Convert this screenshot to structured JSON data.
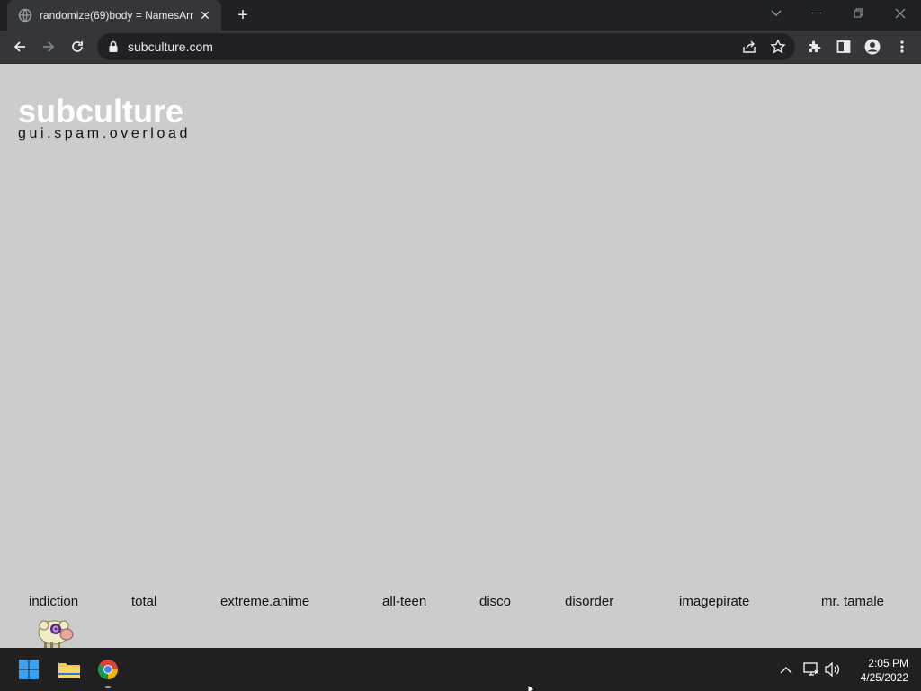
{
  "browser": {
    "tab_title": "randomize(69)body = NamesArr",
    "url": "subculture.com"
  },
  "page": {
    "logo": "subculture",
    "tagline": "gui.spam.overload",
    "nav": [
      "indiction",
      "total",
      "extreme.anime",
      "all-teen",
      "disco",
      "disorder",
      "imagepirate",
      "mr. tamale"
    ]
  },
  "taskbar": {
    "time": "2:05 PM",
    "date": "4/25/2022"
  },
  "colors": {
    "page_bg": "#cccccc",
    "logo": "#ffffff",
    "chrome_dark": "#202124",
    "taskbar": "#202020"
  },
  "icons": [
    "globe-icon",
    "close-icon",
    "plus-icon",
    "chevron-down-icon",
    "minimize-icon",
    "restore-icon",
    "back-icon",
    "forward-icon",
    "reload-icon",
    "lock-icon",
    "share-icon",
    "star-icon",
    "extensions-icon",
    "side-panel-icon",
    "profile-icon",
    "menu-icon",
    "windows-start-icon",
    "file-explorer-icon",
    "chrome-icon",
    "chevron-up-icon",
    "network-icon",
    "volume-icon"
  ]
}
